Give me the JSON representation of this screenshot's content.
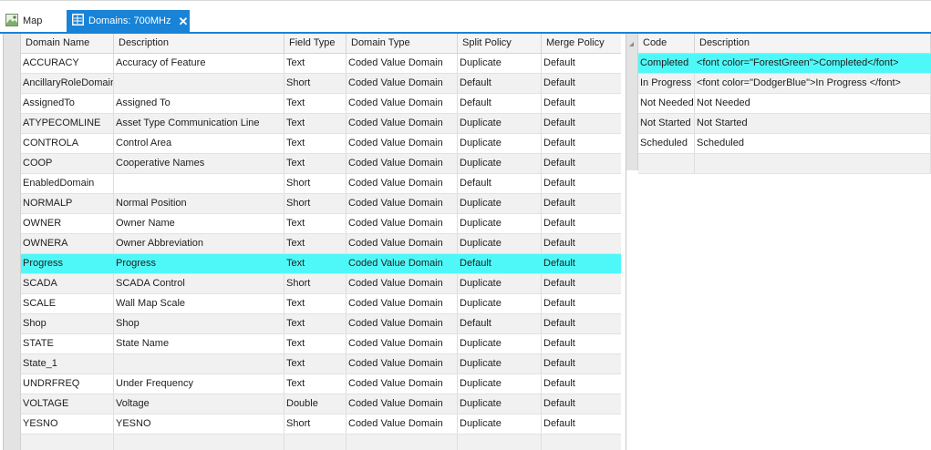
{
  "tabs": [
    {
      "label": "Map",
      "icon": "map-icon",
      "active": false
    },
    {
      "label": "Domains: 700MHz",
      "icon": "domains-table-icon",
      "active": true,
      "close": "✕"
    }
  ],
  "colors": {
    "accent": "#1883d7",
    "selected_row": "#4ff8f8"
  },
  "domains_table": {
    "columns": [
      "Domain Name",
      "Description",
      "Field Type",
      "Domain Type",
      "Split Policy",
      "Merge Policy"
    ],
    "rows": [
      [
        "ACCURACY",
        "Accuracy of Feature",
        "Text",
        "Coded Value Domain",
        "Duplicate",
        "Default"
      ],
      [
        "AncillaryRoleDomain",
        "",
        "Short",
        "Coded Value Domain",
        "Default",
        "Default"
      ],
      [
        "AssignedTo",
        "Assigned To",
        "Text",
        "Coded Value Domain",
        "Default",
        "Default"
      ],
      [
        "ATYPECOMLINE",
        "Asset Type Communication Line",
        "Text",
        "Coded Value Domain",
        "Duplicate",
        "Default"
      ],
      [
        "CONTROLA",
        "Control Area",
        "Text",
        "Coded Value Domain",
        "Duplicate",
        "Default"
      ],
      [
        "COOP",
        "Cooperative Names",
        "Text",
        "Coded Value Domain",
        "Duplicate",
        "Default"
      ],
      [
        "EnabledDomain",
        "",
        "Short",
        "Coded Value Domain",
        "Default",
        "Default"
      ],
      [
        "NORMALP",
        "Normal Position",
        "Short",
        "Coded Value Domain",
        "Duplicate",
        "Default"
      ],
      [
        "OWNER",
        "Owner Name",
        "Text",
        "Coded Value Domain",
        "Duplicate",
        "Default"
      ],
      [
        "OWNERA",
        "Owner Abbreviation",
        "Text",
        "Coded Value Domain",
        "Duplicate",
        "Default"
      ],
      [
        "Progress",
        "Progress",
        "Text",
        "Coded Value Domain",
        "Default",
        "Default"
      ],
      [
        "SCADA",
        "SCADA Control",
        "Short",
        "Coded Value Domain",
        "Duplicate",
        "Default"
      ],
      [
        "SCALE",
        "Wall Map Scale",
        "Text",
        "Coded Value Domain",
        "Duplicate",
        "Default"
      ],
      [
        "Shop",
        "Shop",
        "Text",
        "Coded Value Domain",
        "Default",
        "Default"
      ],
      [
        "STATE",
        "State Name",
        "Text",
        "Coded Value Domain",
        "Duplicate",
        "Default"
      ],
      [
        "State_1",
        "",
        "Text",
        "Coded Value Domain",
        "Duplicate",
        "Default"
      ],
      [
        "UNDRFREQ",
        "Under Frequency",
        "Text",
        "Coded Value Domain",
        "Duplicate",
        "Default"
      ],
      [
        "VOLTAGE",
        "Voltage",
        "Double",
        "Coded Value Domain",
        "Duplicate",
        "Default"
      ],
      [
        "YESNO",
        "YESNO",
        "Short",
        "Coded Value Domain",
        "Duplicate",
        "Default"
      ]
    ],
    "selected_index": 10
  },
  "codes_table": {
    "columns": [
      "Code",
      "Description"
    ],
    "rows": [
      [
        "Completed",
        "<font color=\"ForestGreen\">Completed</font>"
      ],
      [
        "In Progress",
        "<font color=\"DodgerBlue\">In Progress </font>"
      ],
      [
        "Not Needed",
        "Not Needed"
      ],
      [
        "Not Started",
        "Not Started"
      ],
      [
        "Scheduled",
        "Scheduled"
      ]
    ],
    "selected_index": 0
  }
}
